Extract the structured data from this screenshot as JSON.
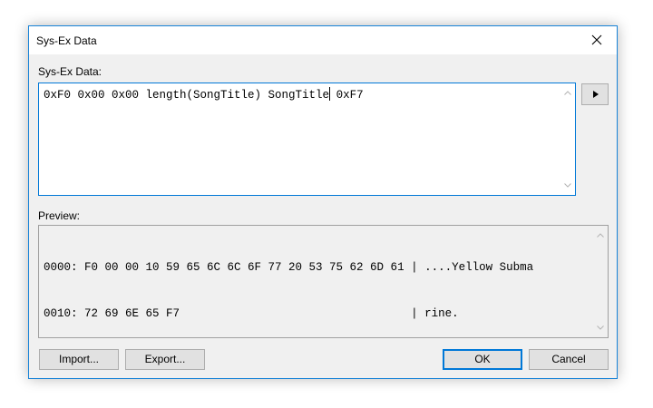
{
  "window": {
    "title": "Sys-Ex Data"
  },
  "sysex": {
    "label": "Sys-Ex Data:",
    "value_before_caret": "0xF0 0x00 0x00 length(SongTitle) SongTitle",
    "value_after_caret": " 0xF7"
  },
  "preview": {
    "label": "Preview:",
    "lines": [
      "0000: F0 00 00 10 59 65 6C 6C 6F 77 20 53 75 62 6D 61 | ....Yellow Subma",
      "0010: 72 69 6E 65 F7                                  | rine."
    ]
  },
  "buttons": {
    "import": "Import...",
    "export": "Export...",
    "ok": "OK",
    "cancel": "Cancel"
  },
  "icons": {
    "close": "close-icon",
    "play": "play-icon",
    "scroll_up": "chevron-up-icon",
    "scroll_down": "chevron-down-icon"
  },
  "colors": {
    "accent": "#0078d7",
    "dialog_bg": "#f0f0f0",
    "window_border": "#1883d7"
  }
}
